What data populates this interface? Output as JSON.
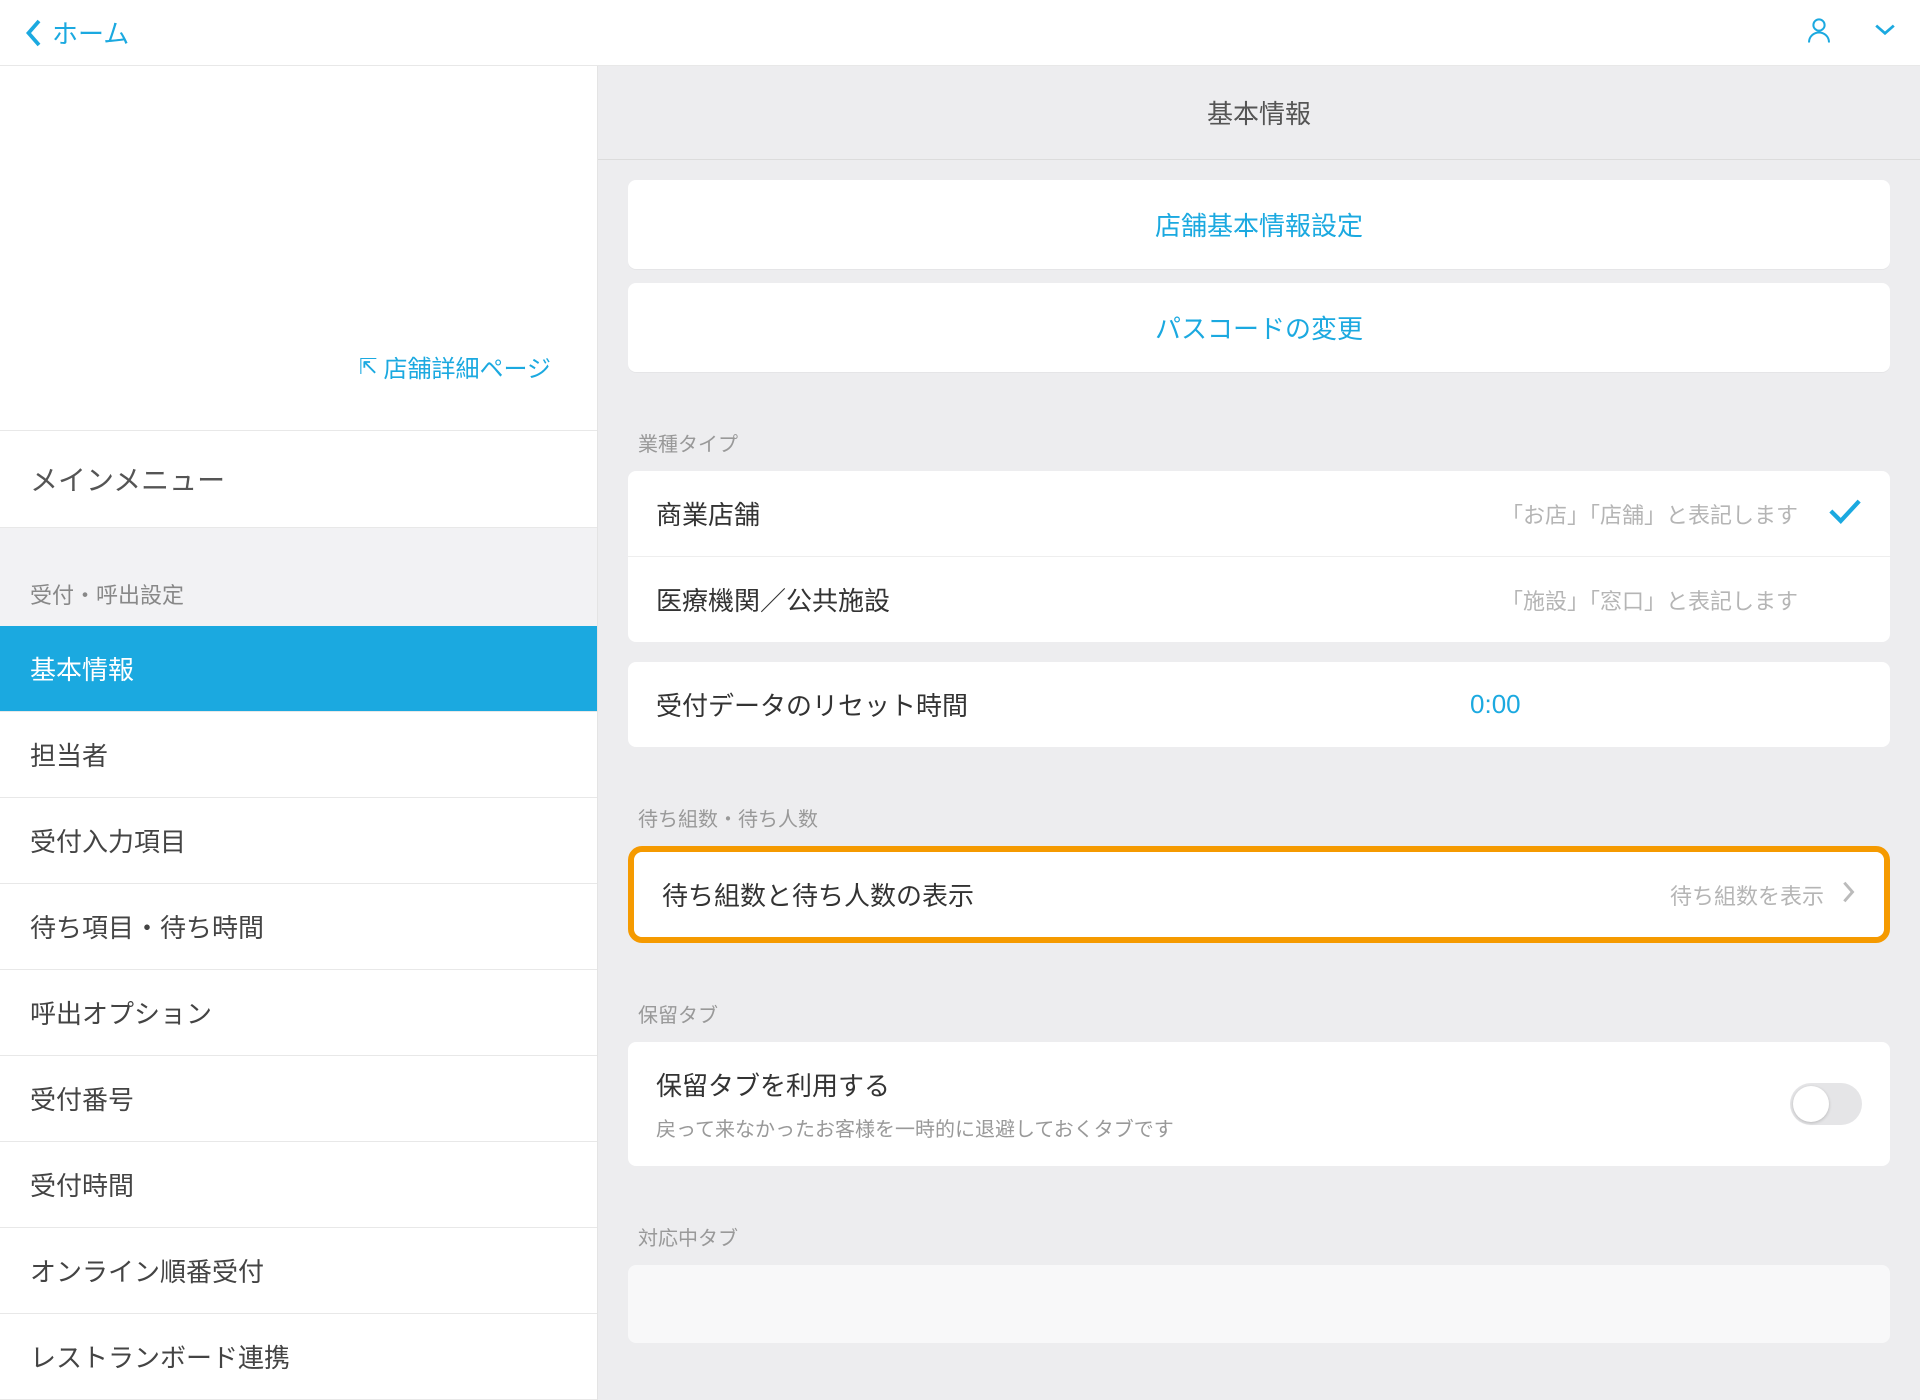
{
  "topbar": {
    "back_label": "ホーム"
  },
  "sidebar": {
    "store_link": "店舗詳細ページ",
    "main_menu": "メインメニュー",
    "section_title": "受付・呼出設定",
    "items": [
      "基本情報",
      "担当者",
      "受付入力項目",
      "待ち項目・待ち時間",
      "呼出オプション",
      "受付番号",
      "受付時間",
      "オンライン順番受付",
      "レストランボード連携"
    ]
  },
  "content": {
    "title": "基本情報",
    "btn_basic": "店舗基本情報設定",
    "btn_passcode": "パスコードの変更",
    "g_business": "業種タイプ",
    "business": {
      "opt1": "商業店舗",
      "opt1_desc": "「お店」「店舗」と表記します",
      "opt2": "医療機関／公共施設",
      "opt2_desc": "「施設」「窓口」と表記します"
    },
    "reset": {
      "label": "受付データのリセット時間",
      "value": "0:00"
    },
    "g_wait": "待ち組数・待ち人数",
    "wait_row": {
      "label": "待ち組数と待ち人数の表示",
      "value": "待ち組数を表示"
    },
    "g_hold": "保留タブ",
    "hold_row": {
      "label": "保留タブを利用する",
      "sub": "戻って来なかったお客様を一時的に退避しておくタブです"
    },
    "g_progress": "対応中タブ"
  }
}
